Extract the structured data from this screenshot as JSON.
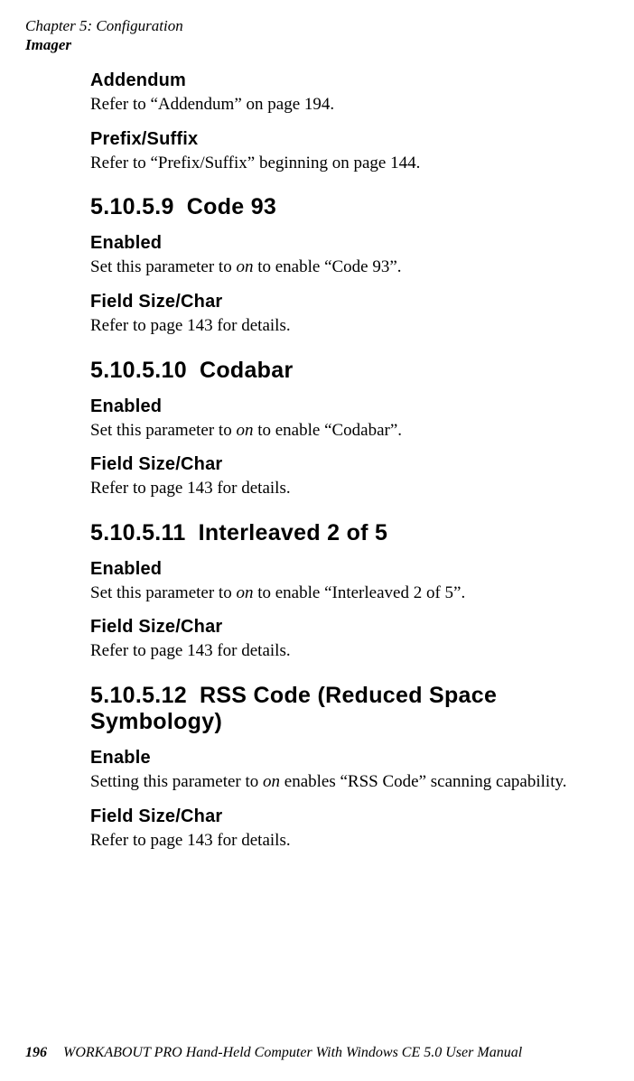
{
  "header": {
    "chapter_line": "Chapter 5: Configuration",
    "section_line": "Imager"
  },
  "sections": {
    "addendum": {
      "title": "Addendum",
      "body_a": "Refer to “Addendum” on page 194."
    },
    "prefix": {
      "title": "Prefix/Suffix",
      "body_a": "Refer to “Prefix/Suffix” beginning on page 144."
    },
    "code93": {
      "num": "5.10.5.9",
      "title": "Code 93",
      "enabled_title": "Enabled",
      "enabled_body_a": "Set this parameter to ",
      "enabled_body_em": "on",
      "enabled_body_b": " to enable “Code 93”.",
      "fsc_title": "Field Size/Char",
      "fsc_body_a": "Refer to page 143 for details."
    },
    "codabar": {
      "num": "5.10.5.10",
      "title": "Codabar",
      "enabled_title": "Enabled",
      "enabled_body_a": "Set this parameter to ",
      "enabled_body_em": "on",
      "enabled_body_b": " to enable “Codabar”.",
      "fsc_title": "Field Size/Char",
      "fsc_body_a": "Refer to page 143 for details."
    },
    "i2o5": {
      "num": "5.10.5.11",
      "title": "Interleaved 2 of 5",
      "enabled_title": "Enabled",
      "enabled_body_a": "Set this parameter to ",
      "enabled_body_em": "on",
      "enabled_body_b": " to enable “Interleaved 2 of 5”.",
      "fsc_title": "Field Size/Char",
      "fsc_body_a": "Refer to page 143 for details."
    },
    "rss": {
      "num": "5.10.5.12",
      "title": "RSS Code (Reduced Space Symbology)",
      "enabled_title": "Enable",
      "enabled_body_a": "Setting this parameter to ",
      "enabled_body_em": "on",
      "enabled_body_b": " enables “RSS Code” scanning capability.",
      "fsc_title": "Field Size/Char",
      "fsc_body_a": "Refer to page 143 for details."
    }
  },
  "footer": {
    "page_number": "196",
    "manual_title": "WORKABOUT PRO Hand-Held Computer With Windows CE 5.0 User Manual"
  }
}
